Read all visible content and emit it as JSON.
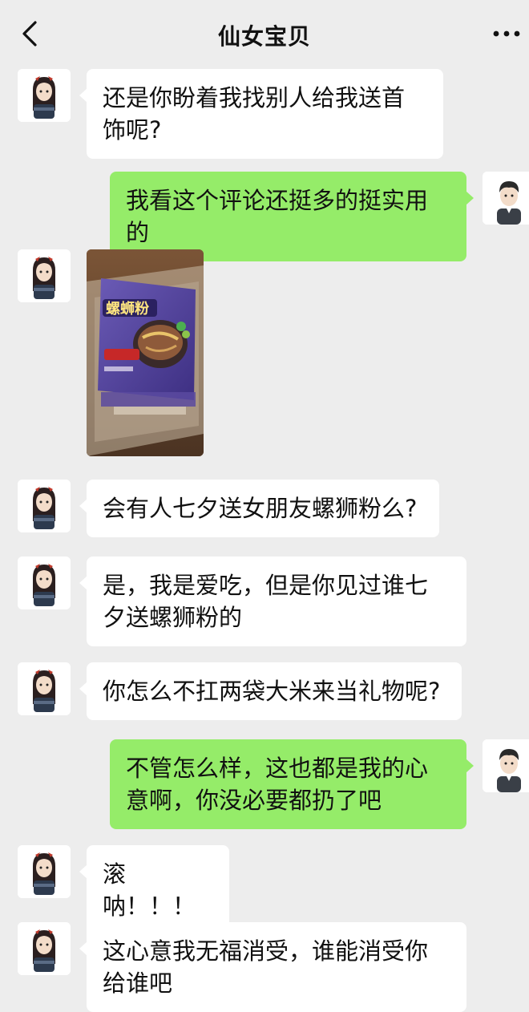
{
  "header": {
    "title": "仙女宝贝",
    "back_icon": "chevron-left-icon",
    "more_icon": "more-dots-icon"
  },
  "colors": {
    "background": "#ededed",
    "bubble_received": "#ffffff",
    "bubble_sent": "#95ec69"
  },
  "messages": [
    {
      "side": "left",
      "text": "还是你盼着我找别人给我送首饰呢?"
    },
    {
      "side": "right",
      "text": "我看这个评论还挺多的挺实用的"
    },
    {
      "side": "left",
      "type": "image"
    },
    {
      "side": "left",
      "text": "会有人七夕送女朋友螺狮粉么?"
    },
    {
      "side": "left",
      "text": "是，我是爱吃，但是你见过谁七夕送螺狮粉的"
    },
    {
      "side": "left",
      "text": "你怎么不扛两袋大米来当礼物呢?"
    },
    {
      "side": "right",
      "text": "不管怎么样，这也都是我的心意啊，你没必要都扔了吧"
    },
    {
      "side": "left",
      "text": "滚呐！！！"
    },
    {
      "side": "left",
      "text": "这心意我无福消受，谁能消受你给谁吧"
    }
  ]
}
